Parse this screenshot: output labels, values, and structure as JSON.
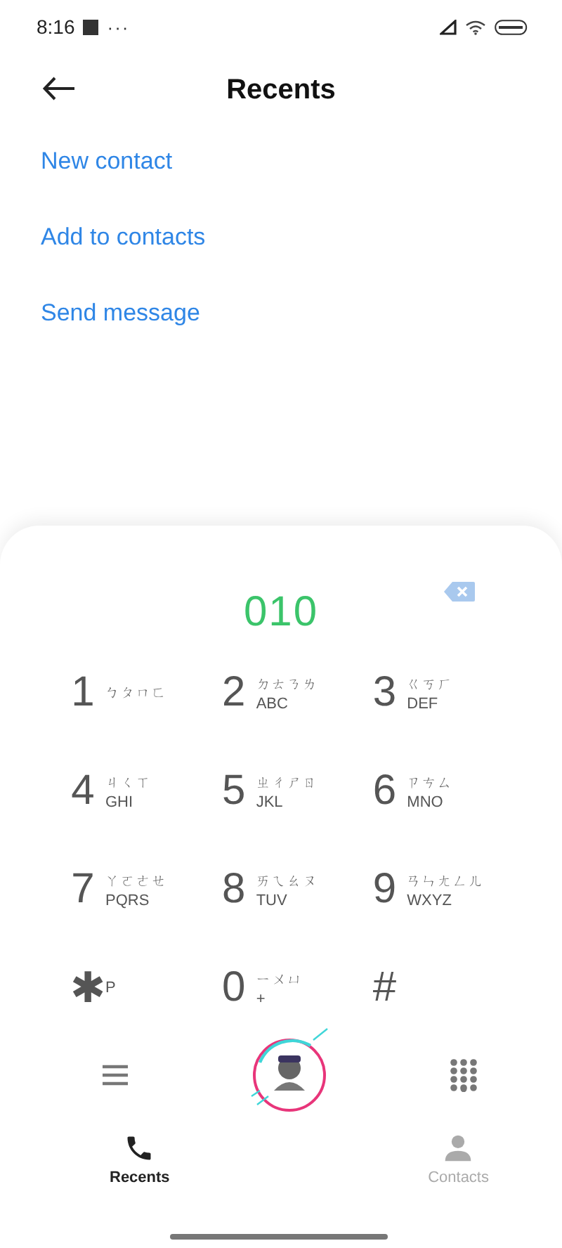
{
  "status_bar": {
    "time": "8:16",
    "more": "···"
  },
  "header": {
    "title": "Recents"
  },
  "actions": [
    "New contact",
    "Add to contacts",
    "Send message"
  ],
  "dialer": {
    "number": "010",
    "keys": [
      {
        "digit": "1",
        "zhuyin": "ㄅㄆㄇㄈ"
      },
      {
        "digit": "2",
        "zhuyin": "ㄉㄊㄋㄌ",
        "letters": "ABC"
      },
      {
        "digit": "3",
        "zhuyin": "ㄍㄎㄏ",
        "letters": "DEF"
      },
      {
        "digit": "4",
        "zhuyin": "ㄐㄑㄒ",
        "letters": "GHI"
      },
      {
        "digit": "5",
        "zhuyin": "ㄓㄔㄕㄖ",
        "letters": "JKL"
      },
      {
        "digit": "6",
        "zhuyin": "ㄗㄘㄙ",
        "letters": "MNO"
      },
      {
        "digit": "7",
        "zhuyin": "ㄚㄛㄜㄝ",
        "letters": "PQRS"
      },
      {
        "digit": "8",
        "zhuyin": "ㄞㄟㄠㄡ",
        "letters": "TUV"
      },
      {
        "digit": "9",
        "zhuyin": "ㄢㄣㄤㄥㄦ",
        "letters": "WXYZ"
      },
      {
        "digit": "✱",
        "letters": "P"
      },
      {
        "digit": "0",
        "zhuyin": "ㄧㄨㄩ",
        "letters": "+"
      },
      {
        "digit": "#"
      }
    ]
  },
  "bottom_nav": [
    {
      "label": "Recents",
      "kind": "phone",
      "selected": true
    },
    {
      "label": "Contacts",
      "kind": "person",
      "selected": false
    }
  ]
}
